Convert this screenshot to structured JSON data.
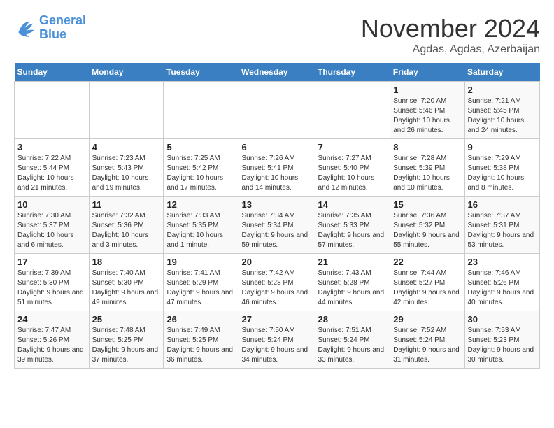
{
  "logo": {
    "line1": "General",
    "line2": "Blue"
  },
  "title": {
    "month_year": "November 2024",
    "location": "Agdas, Agdas, Azerbaijan"
  },
  "days_of_week": [
    "Sunday",
    "Monday",
    "Tuesday",
    "Wednesday",
    "Thursday",
    "Friday",
    "Saturday"
  ],
  "weeks": [
    [
      {
        "day": "",
        "info": ""
      },
      {
        "day": "",
        "info": ""
      },
      {
        "day": "",
        "info": ""
      },
      {
        "day": "",
        "info": ""
      },
      {
        "day": "",
        "info": ""
      },
      {
        "day": "1",
        "info": "Sunrise: 7:20 AM\nSunset: 5:46 PM\nDaylight: 10 hours and 26 minutes."
      },
      {
        "day": "2",
        "info": "Sunrise: 7:21 AM\nSunset: 5:45 PM\nDaylight: 10 hours and 24 minutes."
      }
    ],
    [
      {
        "day": "3",
        "info": "Sunrise: 7:22 AM\nSunset: 5:44 PM\nDaylight: 10 hours and 21 minutes."
      },
      {
        "day": "4",
        "info": "Sunrise: 7:23 AM\nSunset: 5:43 PM\nDaylight: 10 hours and 19 minutes."
      },
      {
        "day": "5",
        "info": "Sunrise: 7:25 AM\nSunset: 5:42 PM\nDaylight: 10 hours and 17 minutes."
      },
      {
        "day": "6",
        "info": "Sunrise: 7:26 AM\nSunset: 5:41 PM\nDaylight: 10 hours and 14 minutes."
      },
      {
        "day": "7",
        "info": "Sunrise: 7:27 AM\nSunset: 5:40 PM\nDaylight: 10 hours and 12 minutes."
      },
      {
        "day": "8",
        "info": "Sunrise: 7:28 AM\nSunset: 5:39 PM\nDaylight: 10 hours and 10 minutes."
      },
      {
        "day": "9",
        "info": "Sunrise: 7:29 AM\nSunset: 5:38 PM\nDaylight: 10 hours and 8 minutes."
      }
    ],
    [
      {
        "day": "10",
        "info": "Sunrise: 7:30 AM\nSunset: 5:37 PM\nDaylight: 10 hours and 6 minutes."
      },
      {
        "day": "11",
        "info": "Sunrise: 7:32 AM\nSunset: 5:36 PM\nDaylight: 10 hours and 3 minutes."
      },
      {
        "day": "12",
        "info": "Sunrise: 7:33 AM\nSunset: 5:35 PM\nDaylight: 10 hours and 1 minute."
      },
      {
        "day": "13",
        "info": "Sunrise: 7:34 AM\nSunset: 5:34 PM\nDaylight: 9 hours and 59 minutes."
      },
      {
        "day": "14",
        "info": "Sunrise: 7:35 AM\nSunset: 5:33 PM\nDaylight: 9 hours and 57 minutes."
      },
      {
        "day": "15",
        "info": "Sunrise: 7:36 AM\nSunset: 5:32 PM\nDaylight: 9 hours and 55 minutes."
      },
      {
        "day": "16",
        "info": "Sunrise: 7:37 AM\nSunset: 5:31 PM\nDaylight: 9 hours and 53 minutes."
      }
    ],
    [
      {
        "day": "17",
        "info": "Sunrise: 7:39 AM\nSunset: 5:30 PM\nDaylight: 9 hours and 51 minutes."
      },
      {
        "day": "18",
        "info": "Sunrise: 7:40 AM\nSunset: 5:30 PM\nDaylight: 9 hours and 49 minutes."
      },
      {
        "day": "19",
        "info": "Sunrise: 7:41 AM\nSunset: 5:29 PM\nDaylight: 9 hours and 47 minutes."
      },
      {
        "day": "20",
        "info": "Sunrise: 7:42 AM\nSunset: 5:28 PM\nDaylight: 9 hours and 46 minutes."
      },
      {
        "day": "21",
        "info": "Sunrise: 7:43 AM\nSunset: 5:28 PM\nDaylight: 9 hours and 44 minutes."
      },
      {
        "day": "22",
        "info": "Sunrise: 7:44 AM\nSunset: 5:27 PM\nDaylight: 9 hours and 42 minutes."
      },
      {
        "day": "23",
        "info": "Sunrise: 7:46 AM\nSunset: 5:26 PM\nDaylight: 9 hours and 40 minutes."
      }
    ],
    [
      {
        "day": "24",
        "info": "Sunrise: 7:47 AM\nSunset: 5:26 PM\nDaylight: 9 hours and 39 minutes."
      },
      {
        "day": "25",
        "info": "Sunrise: 7:48 AM\nSunset: 5:25 PM\nDaylight: 9 hours and 37 minutes."
      },
      {
        "day": "26",
        "info": "Sunrise: 7:49 AM\nSunset: 5:25 PM\nDaylight: 9 hours and 36 minutes."
      },
      {
        "day": "27",
        "info": "Sunrise: 7:50 AM\nSunset: 5:24 PM\nDaylight: 9 hours and 34 minutes."
      },
      {
        "day": "28",
        "info": "Sunrise: 7:51 AM\nSunset: 5:24 PM\nDaylight: 9 hours and 33 minutes."
      },
      {
        "day": "29",
        "info": "Sunrise: 7:52 AM\nSunset: 5:24 PM\nDaylight: 9 hours and 31 minutes."
      },
      {
        "day": "30",
        "info": "Sunrise: 7:53 AM\nSunset: 5:23 PM\nDaylight: 9 hours and 30 minutes."
      }
    ]
  ]
}
